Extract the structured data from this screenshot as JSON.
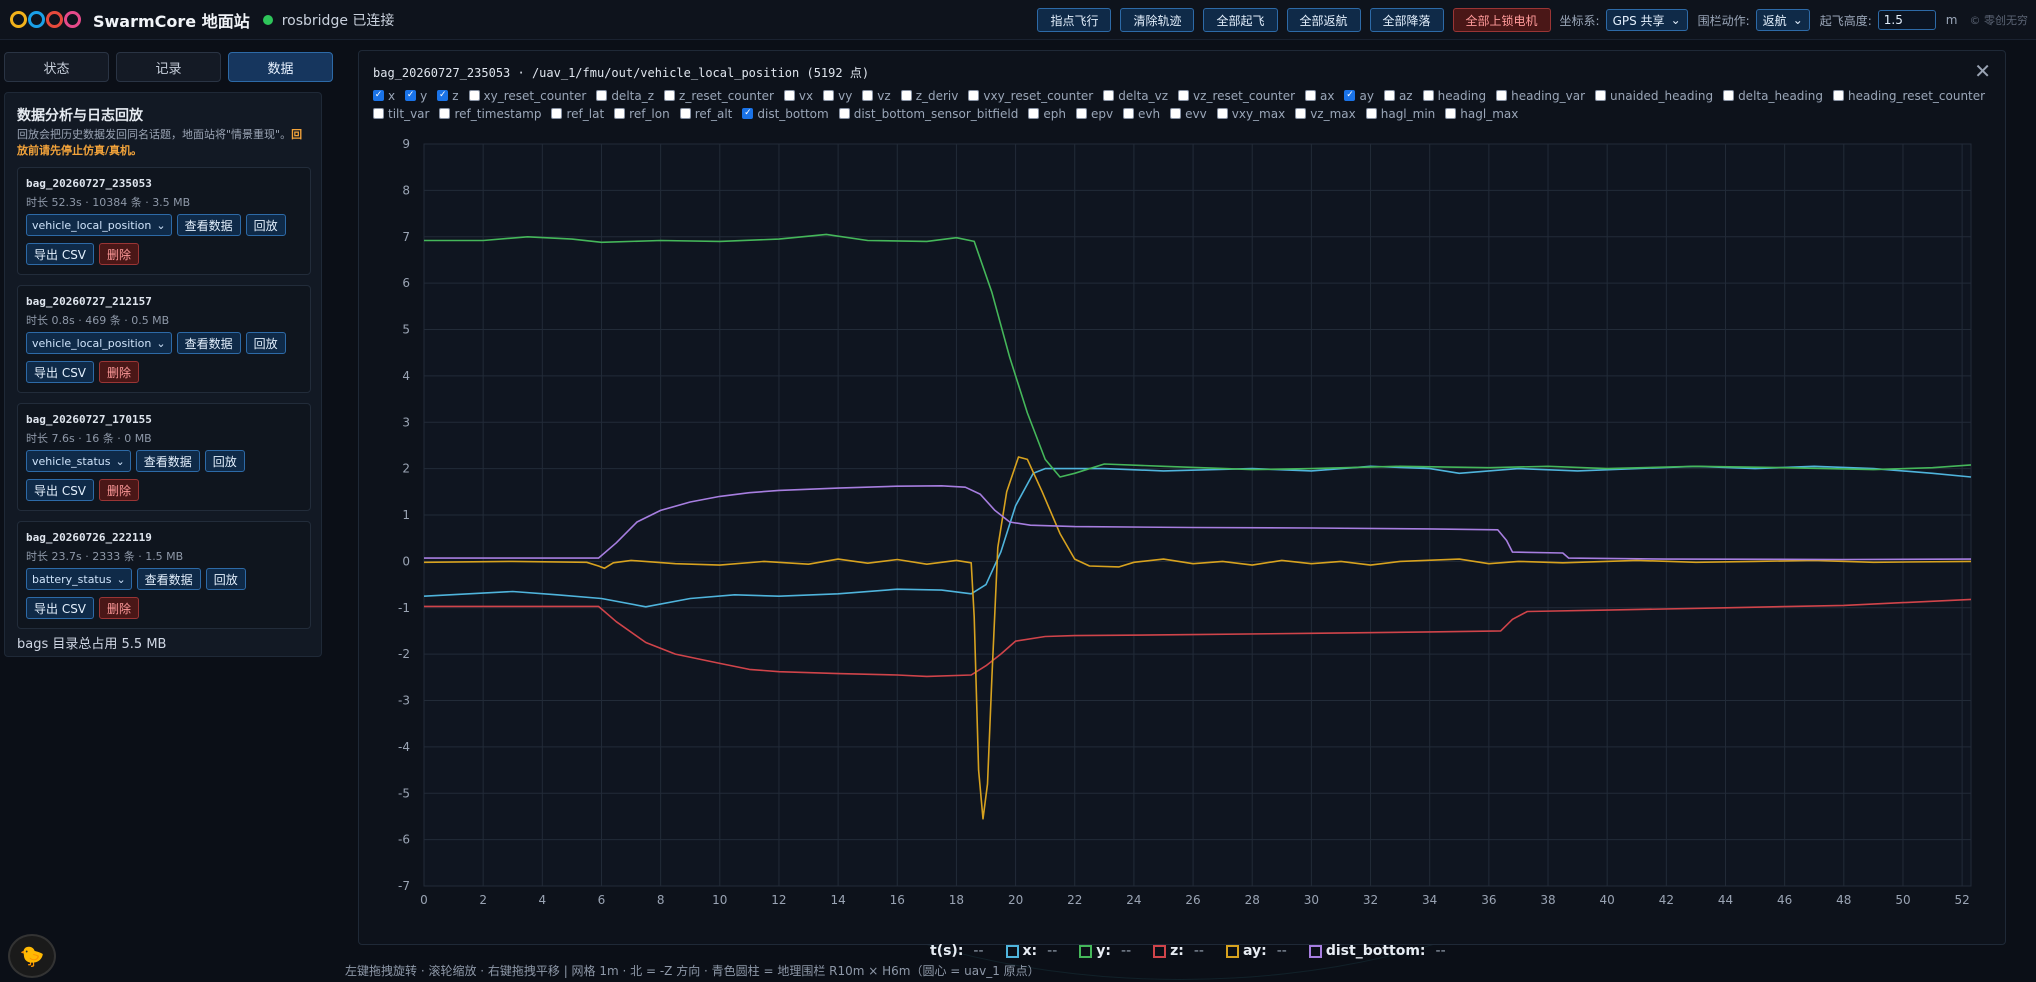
{
  "app": {
    "title": "SwarmCore 地面站",
    "connection": "rosbridge 已连接"
  },
  "toolbar": {
    "buttons": [
      "指点飞行",
      "清除轨迹",
      "全部起飞",
      "全部返航",
      "全部降落"
    ],
    "danger_button": "全部上锁电机",
    "coord_label": "坐标系:",
    "coord_value": "GPS 共享",
    "fence_label": "围栏动作:",
    "fence_value": "返航",
    "alt_label": "起飞高度:",
    "alt_value": "1.5",
    "alt_unit": "m",
    "corner_text": "© 零创无穷"
  },
  "tabs": [
    {
      "label": "状态",
      "active": false
    },
    {
      "label": "记录",
      "active": false
    },
    {
      "label": "数据",
      "active": true
    }
  ],
  "panel": {
    "title": "数据分析与日志回放",
    "desc": "回放会把历史数据发回同名话题，地面站将\"情景重现\"。",
    "warning": "回放前请先停止仿真/真机。",
    "bags": [
      {
        "name": "bag_20260727_235053",
        "meta": "时长 52.3s · 10384 条 · 3.5 MB",
        "topic": "vehicle_local_position"
      },
      {
        "name": "bag_20260727_212157",
        "meta": "时长 0.8s · 469 条 · 0.5 MB",
        "topic": "vehicle_local_position"
      },
      {
        "name": "bag_20260727_170155",
        "meta": "时长 7.6s · 16 条 · 0 MB",
        "topic": "vehicle_status"
      },
      {
        "name": "bag_20260726_222119",
        "meta": "时长 23.7s · 2333 条 · 1.5 MB",
        "topic": "battery_status"
      }
    ],
    "btn_view": "查看数据",
    "btn_replay": "回放",
    "btn_export": "导出 CSV",
    "btn_delete": "删除",
    "total": "bags 目录总占用 5.5 MB"
  },
  "modal": {
    "title": "bag_20260727_235053 · /uav_1/fmu/out/vehicle_local_position (5192 点)",
    "fields": [
      {
        "name": "x",
        "checked": true
      },
      {
        "name": "y",
        "checked": true
      },
      {
        "name": "z",
        "checked": true
      },
      {
        "name": "xy_reset_counter",
        "checked": false
      },
      {
        "name": "delta_z",
        "checked": false
      },
      {
        "name": "z_reset_counter",
        "checked": false
      },
      {
        "name": "vx",
        "checked": false
      },
      {
        "name": "vy",
        "checked": false
      },
      {
        "name": "vz",
        "checked": false
      },
      {
        "name": "z_deriv",
        "checked": false
      },
      {
        "name": "vxy_reset_counter",
        "checked": false
      },
      {
        "name": "delta_vz",
        "checked": false
      },
      {
        "name": "vz_reset_counter",
        "checked": false
      },
      {
        "name": "ax",
        "checked": false
      },
      {
        "name": "ay",
        "checked": true
      },
      {
        "name": "az",
        "checked": false
      },
      {
        "name": "heading",
        "checked": false
      },
      {
        "name": "heading_var",
        "checked": false
      },
      {
        "name": "unaided_heading",
        "checked": false
      },
      {
        "name": "delta_heading",
        "checked": false
      },
      {
        "name": "heading_reset_counter",
        "checked": false
      },
      {
        "name": "tilt_var",
        "checked": false
      },
      {
        "name": "ref_timestamp",
        "checked": false
      },
      {
        "name": "ref_lat",
        "checked": false
      },
      {
        "name": "ref_lon",
        "checked": false
      },
      {
        "name": "ref_alt",
        "checked": false
      },
      {
        "name": "dist_bottom",
        "checked": true
      },
      {
        "name": "dist_bottom_sensor_bitfield",
        "checked": false
      },
      {
        "name": "eph",
        "checked": false
      },
      {
        "name": "epv",
        "checked": false
      },
      {
        "name": "evh",
        "checked": false
      },
      {
        "name": "evv",
        "checked": false
      },
      {
        "name": "vxy_max",
        "checked": false
      },
      {
        "name": "vz_max",
        "checked": false
      },
      {
        "name": "hagl_min",
        "checked": false
      },
      {
        "name": "hagl_max",
        "checked": false
      }
    ]
  },
  "chart_data": {
    "type": "line",
    "title": "",
    "xlabel": "",
    "ylabel": "",
    "xlim": [
      0,
      52.3
    ],
    "ylim": [
      -7,
      9
    ],
    "xticks": [
      0,
      2,
      4,
      6,
      8,
      10,
      12,
      14,
      16,
      18,
      20,
      22,
      24,
      26,
      28,
      30,
      32,
      34,
      36,
      38,
      40,
      42,
      44,
      46,
      48,
      50,
      52
    ],
    "yticks": [
      -7,
      -6,
      -5,
      -4,
      -3,
      -2,
      -1,
      0,
      1,
      2,
      3,
      4,
      5,
      6,
      7,
      8,
      9
    ],
    "grid": true,
    "series": [
      {
        "name": "x",
        "color": "#4fb4dc",
        "points": [
          [
            0,
            -0.75
          ],
          [
            3,
            -0.65
          ],
          [
            4.5,
            -0.72
          ],
          [
            6,
            -0.8
          ],
          [
            7.5,
            -0.98
          ],
          [
            9,
            -0.8
          ],
          [
            10.5,
            -0.72
          ],
          [
            12,
            -0.75
          ],
          [
            14,
            -0.7
          ],
          [
            16,
            -0.6
          ],
          [
            17.5,
            -0.62
          ],
          [
            18.5,
            -0.7
          ],
          [
            19,
            -0.5
          ],
          [
            19.5,
            0.2
          ],
          [
            20,
            1.2
          ],
          [
            20.6,
            1.9
          ],
          [
            21,
            2.0
          ],
          [
            23,
            2.0
          ],
          [
            25,
            1.95
          ],
          [
            28,
            2.0
          ],
          [
            30,
            1.95
          ],
          [
            32,
            2.05
          ],
          [
            34,
            2.0
          ],
          [
            35,
            1.9
          ],
          [
            37,
            2.0
          ],
          [
            39,
            1.95
          ],
          [
            41,
            2.0
          ],
          [
            43,
            2.05
          ],
          [
            45,
            2.0
          ],
          [
            47,
            2.05
          ],
          [
            49,
            2.0
          ],
          [
            51,
            1.9
          ],
          [
            52.3,
            1.82
          ]
        ]
      },
      {
        "name": "y",
        "color": "#45b75a",
        "points": [
          [
            0,
            6.92
          ],
          [
            2,
            6.92
          ],
          [
            3.5,
            7.0
          ],
          [
            5,
            6.95
          ],
          [
            6,
            6.88
          ],
          [
            8,
            6.92
          ],
          [
            10,
            6.9
          ],
          [
            12,
            6.95
          ],
          [
            13.6,
            7.05
          ],
          [
            15,
            6.92
          ],
          [
            17,
            6.9
          ],
          [
            18,
            6.98
          ],
          [
            18.6,
            6.9
          ],
          [
            19.2,
            5.8
          ],
          [
            19.8,
            4.4
          ],
          [
            20.4,
            3.2
          ],
          [
            21,
            2.2
          ],
          [
            21.5,
            1.82
          ],
          [
            22,
            1.9
          ],
          [
            23,
            2.1
          ],
          [
            25,
            2.05
          ],
          [
            28,
            1.98
          ],
          [
            30,
            2.0
          ],
          [
            33,
            2.05
          ],
          [
            36,
            2.02
          ],
          [
            38,
            2.05
          ],
          [
            40,
            2.0
          ],
          [
            43,
            2.05
          ],
          [
            46,
            2.02
          ],
          [
            49,
            1.98
          ],
          [
            51,
            2.02
          ],
          [
            52.3,
            2.08
          ]
        ]
      },
      {
        "name": "z",
        "color": "#d0444a",
        "points": [
          [
            0,
            -0.97
          ],
          [
            5.9,
            -0.97
          ],
          [
            6.5,
            -1.3
          ],
          [
            7.5,
            -1.75
          ],
          [
            8.5,
            -2.0
          ],
          [
            10,
            -2.2
          ],
          [
            11,
            -2.33
          ],
          [
            12,
            -2.38
          ],
          [
            14,
            -2.42
          ],
          [
            16,
            -2.45
          ],
          [
            17,
            -2.48
          ],
          [
            18.5,
            -2.45
          ],
          [
            19,
            -2.25
          ],
          [
            19.5,
            -2.0
          ],
          [
            20,
            -1.72
          ],
          [
            21,
            -1.62
          ],
          [
            22,
            -1.6
          ],
          [
            26,
            -1.58
          ],
          [
            30,
            -1.55
          ],
          [
            34,
            -1.52
          ],
          [
            36.4,
            -1.5
          ],
          [
            36.8,
            -1.25
          ],
          [
            37.3,
            -1.08
          ],
          [
            40,
            -1.05
          ],
          [
            44,
            -1.0
          ],
          [
            48,
            -0.95
          ],
          [
            52.3,
            -0.82
          ]
        ]
      },
      {
        "name": "ay",
        "color": "#d7a21f",
        "points": [
          [
            0,
            -0.02
          ],
          [
            3,
            0.0
          ],
          [
            5.5,
            -0.02
          ],
          [
            5.9,
            -0.1
          ],
          [
            6.1,
            -0.15
          ],
          [
            6.4,
            -0.03
          ],
          [
            7,
            0.02
          ],
          [
            8.5,
            -0.05
          ],
          [
            10,
            -0.08
          ],
          [
            11.5,
            0.0
          ],
          [
            13,
            -0.06
          ],
          [
            14,
            0.05
          ],
          [
            15,
            -0.04
          ],
          [
            16,
            0.04
          ],
          [
            17,
            -0.06
          ],
          [
            18,
            0.02
          ],
          [
            18.5,
            -0.03
          ],
          [
            18.6,
            -1.2
          ],
          [
            18.75,
            -4.5
          ],
          [
            18.9,
            -5.55
          ],
          [
            19.05,
            -4.8
          ],
          [
            19.2,
            -2.5
          ],
          [
            19.4,
            0.3
          ],
          [
            19.7,
            1.5
          ],
          [
            20.1,
            2.25
          ],
          [
            20.4,
            2.2
          ],
          [
            20.9,
            1.5
          ],
          [
            21.5,
            0.6
          ],
          [
            22,
            0.05
          ],
          [
            22.5,
            -0.1
          ],
          [
            23.5,
            -0.12
          ],
          [
            24,
            -0.02
          ],
          [
            25,
            0.05
          ],
          [
            26,
            -0.05
          ],
          [
            27,
            0.0
          ],
          [
            28,
            -0.08
          ],
          [
            29,
            0.02
          ],
          [
            30,
            -0.05
          ],
          [
            31,
            0.0
          ],
          [
            32,
            -0.08
          ],
          [
            33,
            0.0
          ],
          [
            35,
            0.05
          ],
          [
            36,
            -0.05
          ],
          [
            37,
            0.0
          ],
          [
            38.5,
            -0.03
          ],
          [
            41,
            0.02
          ],
          [
            43,
            -0.02
          ],
          [
            45,
            0.0
          ],
          [
            47,
            0.02
          ],
          [
            49,
            -0.02
          ],
          [
            52.3,
            0.0
          ]
        ]
      },
      {
        "name": "dist_bottom",
        "color": "#a77ee0",
        "points": [
          [
            0,
            0.07
          ],
          [
            5.9,
            0.07
          ],
          [
            6.5,
            0.4
          ],
          [
            7.2,
            0.85
          ],
          [
            8,
            1.1
          ],
          [
            9,
            1.28
          ],
          [
            10,
            1.4
          ],
          [
            11,
            1.48
          ],
          [
            12,
            1.53
          ],
          [
            14,
            1.58
          ],
          [
            16,
            1.62
          ],
          [
            17.5,
            1.63
          ],
          [
            18.3,
            1.6
          ],
          [
            18.8,
            1.45
          ],
          [
            19.3,
            1.1
          ],
          [
            19.8,
            0.85
          ],
          [
            20.5,
            0.78
          ],
          [
            22,
            0.75
          ],
          [
            26,
            0.73
          ],
          [
            30,
            0.72
          ],
          [
            34,
            0.7
          ],
          [
            36.3,
            0.68
          ],
          [
            36.6,
            0.45
          ],
          [
            36.8,
            0.2
          ],
          [
            38.5,
            0.18
          ],
          [
            38.7,
            0.07
          ],
          [
            42,
            0.05
          ],
          [
            48,
            0.04
          ],
          [
            52.3,
            0.05
          ]
        ]
      }
    ]
  },
  "legend": {
    "time_label": "t(s):",
    "time_value": "--",
    "items": [
      {
        "name": "x:",
        "value": "--",
        "color": "#4fb4dc"
      },
      {
        "name": "y:",
        "value": "--",
        "color": "#45b75a"
      },
      {
        "name": "z:",
        "value": "--",
        "color": "#d0444a"
      },
      {
        "name": "ay:",
        "value": "--",
        "color": "#d7a21f"
      },
      {
        "name": "dist_bottom:",
        "value": "--",
        "color": "#a77ee0"
      }
    ]
  },
  "footer_hint": "左键拖拽旋转 · 滚轮缩放 · 右键拖拽平移 | 网格 1m · 北 = -Z 方向 · 青色圆柱 = 地理围栏 R10m × H6m（圆心 = uav_1 原点）"
}
